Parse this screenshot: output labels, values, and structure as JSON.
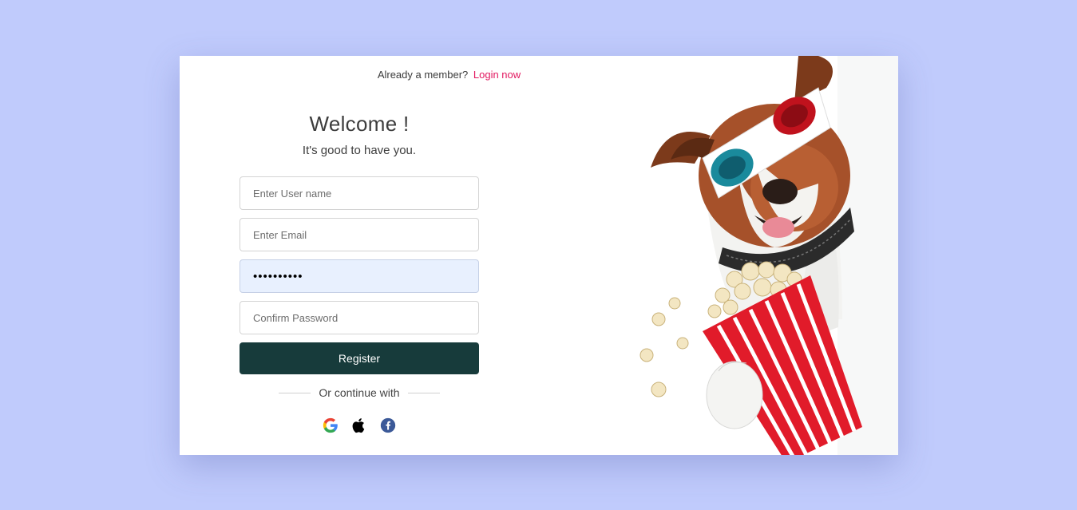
{
  "header": {
    "member_text": "Already a member?",
    "login_link": "Login now"
  },
  "form": {
    "title": "Welcome !",
    "subtitle": "It's good to have you.",
    "username_placeholder": "Enter User name",
    "email_placeholder": "Enter Email",
    "password_value": "••••••••••",
    "confirm_placeholder": "Confirm Password",
    "register_label": "Register",
    "divider_text": "Or continue with"
  },
  "social": [
    "google-icon",
    "apple-icon",
    "facebook-icon"
  ],
  "colors": {
    "page_bg": "#c0cbfc",
    "accent": "#e2175f",
    "button": "#173b3b",
    "autofill": "#e8f0fe"
  }
}
